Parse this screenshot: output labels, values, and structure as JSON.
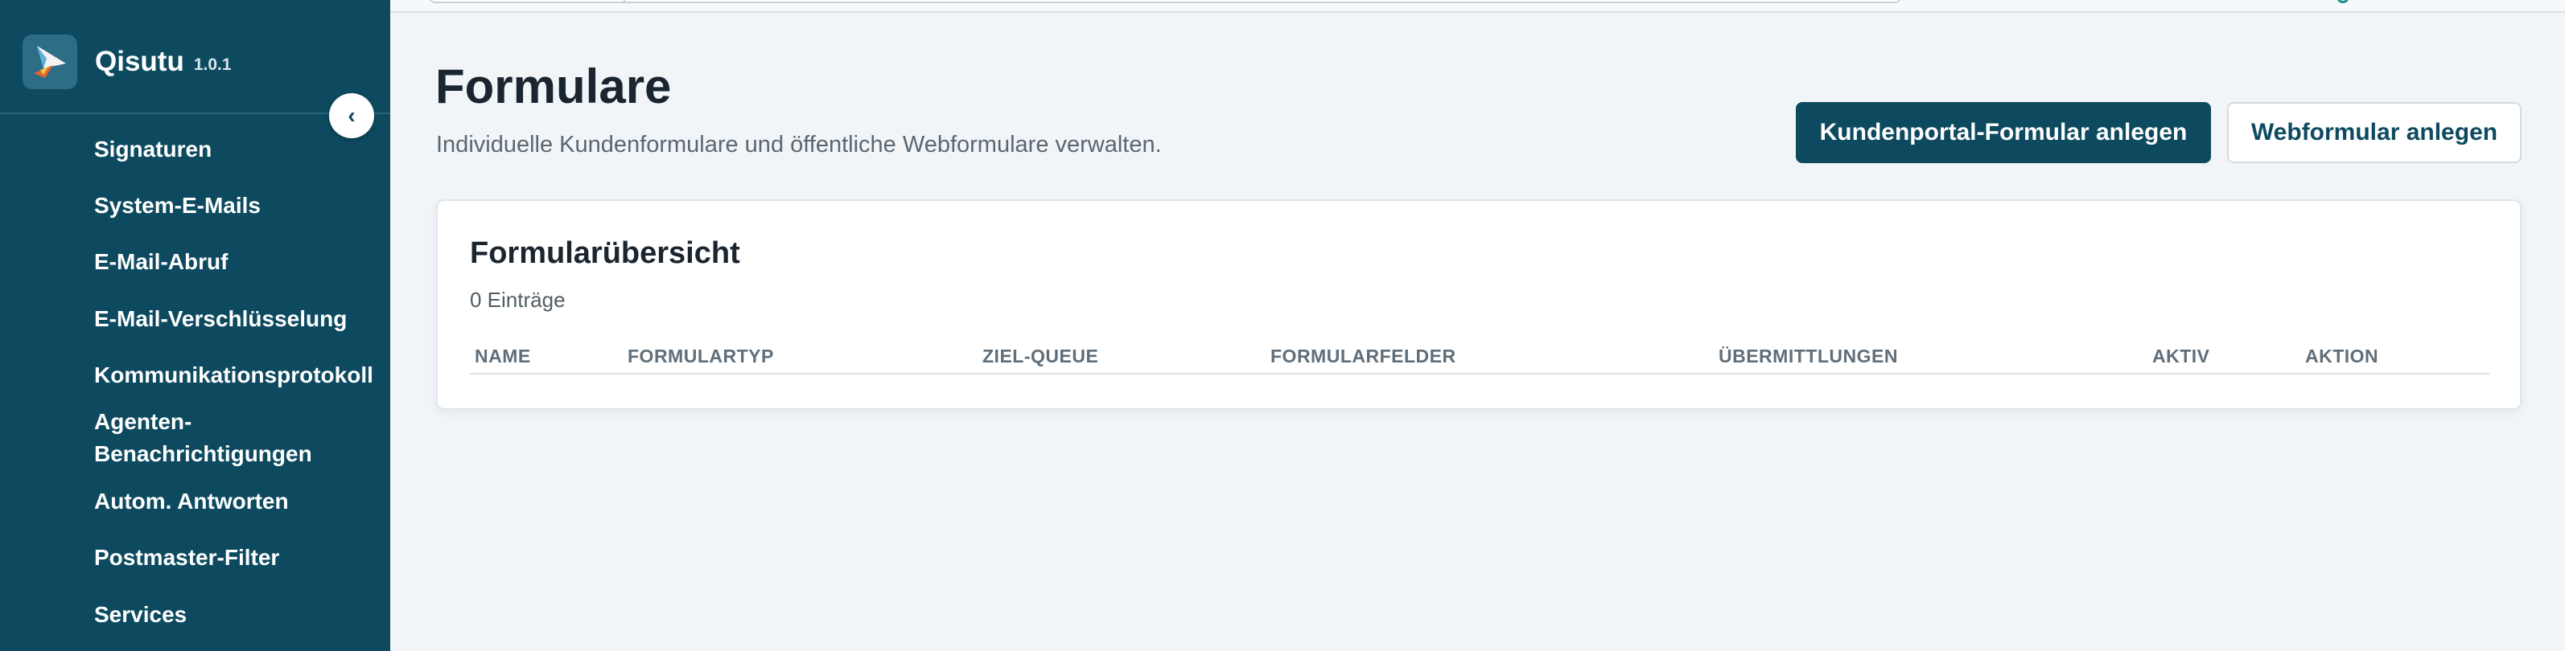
{
  "app": {
    "name": "Qisutu",
    "version": "1.0.1"
  },
  "sidebar": {
    "collapse_icon": "chevron-left-icon",
    "items": [
      {
        "label": "Signaturen"
      },
      {
        "label": "System-E-Mails"
      },
      {
        "label": "E-Mail-Abruf"
      },
      {
        "label": "E-Mail-Verschlüsselung"
      },
      {
        "label": "Kommunikationsprotokoll"
      },
      {
        "label": "Agenten-"
      },
      {
        "label": "Benachrichtigungen"
      },
      {
        "label": "Autom. Antworten"
      },
      {
        "label": "Postmaster-Filter"
      },
      {
        "label": "Services"
      }
    ]
  },
  "header": {
    "title": "Formulare",
    "subtitle": "Individuelle Kundenformulare und öffentliche Webformulare verwalten.",
    "primary_button": "Kundenportal-Formular anlegen",
    "secondary_button": "Webformular anlegen"
  },
  "card": {
    "title": "Formularübersicht",
    "count": "0 Einträge",
    "columns": [
      "NAME",
      "FORMULARTYP",
      "ZIEL-QUEUE",
      "FORMULARFELDER",
      "ÜBERMITTLUNGEN",
      "AKTIV",
      "AKTION"
    ]
  },
  "colors": {
    "sidebar_bg": "#0d4a5f",
    "page_bg": "#f1f5f8",
    "primary": "#0d4a5f"
  }
}
